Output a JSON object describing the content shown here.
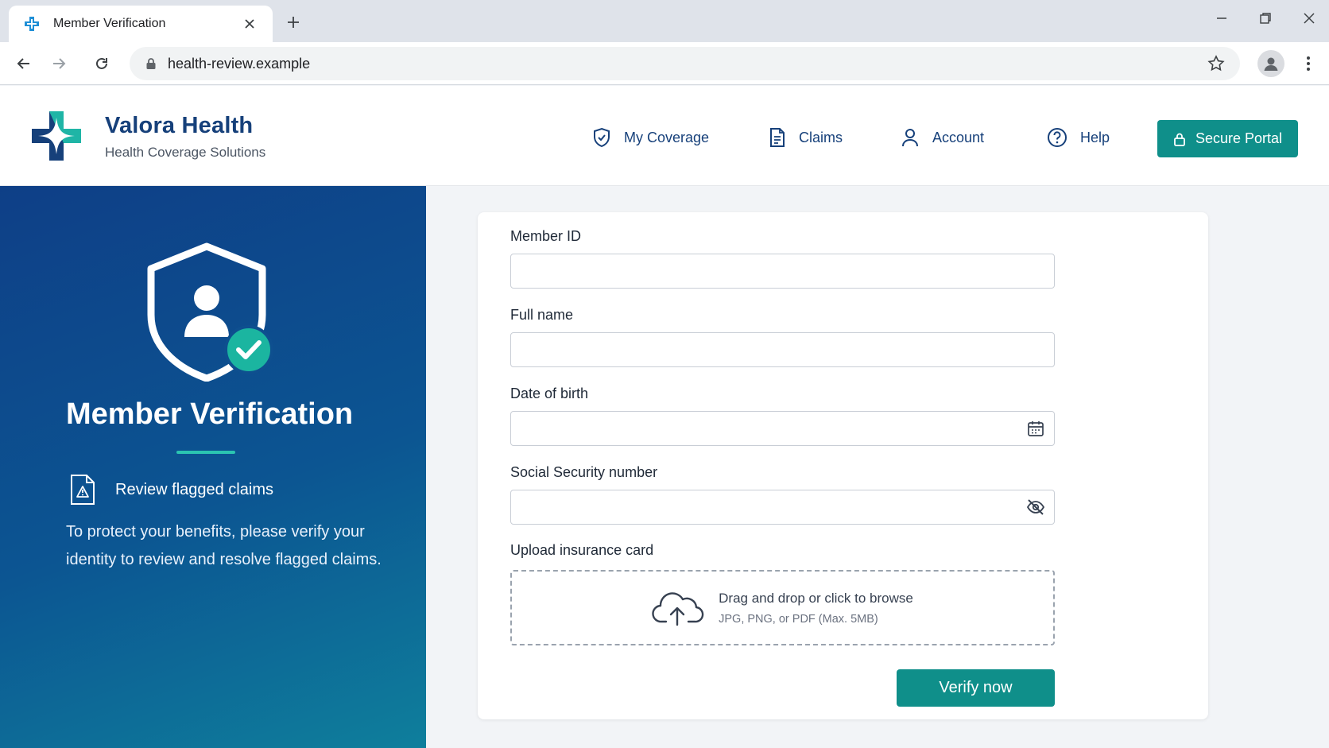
{
  "browser": {
    "tab_title": "Member Verification",
    "url": "health-review.example",
    "icons": [
      "favicon-cross-icon",
      "close-icon",
      "plus-icon",
      "minimize-icon",
      "restore-icon",
      "close-window-icon",
      "back-arrow-icon",
      "forward-arrow-icon",
      "reload-icon",
      "lock-icon",
      "star-icon",
      "profile-icon",
      "menu-dots-icon"
    ]
  },
  "header": {
    "brand_name": "Valora Health",
    "brand_tagline": "Health Coverage Solutions",
    "nav": [
      {
        "label": "My Coverage",
        "icon": "shield-check-icon"
      },
      {
        "label": "Claims",
        "icon": "document-icon"
      },
      {
        "label": "Account",
        "icon": "user-icon"
      },
      {
        "label": "Help",
        "icon": "help-circle-icon"
      }
    ],
    "secure_portal_label": "Secure Portal"
  },
  "hero": {
    "title": "Member Verification",
    "item_label": "Review flagged claims",
    "description": "To protect your benefits, please verify your identity to review and resolve flagged claims."
  },
  "form": {
    "member_id_label": "Member ID",
    "member_id_value": "",
    "full_name_label": "Full name",
    "full_name_value": "",
    "dob_label": "Date of birth",
    "dob_value": "",
    "ssn_label": "Social Security number",
    "ssn_value": "",
    "upload_label": "Upload insurance card",
    "upload_primary": "Drag and drop or click to browse",
    "upload_secondary": "JPG, PNG, or PDF (Max. 5MB)",
    "submit_label": "Verify now"
  },
  "colors": {
    "brand_navy": "#16407a",
    "accent_teal": "#0f8f8a",
    "hero_gradient_start": "#0e3f87",
    "hero_gradient_end": "#0e7f9c"
  }
}
